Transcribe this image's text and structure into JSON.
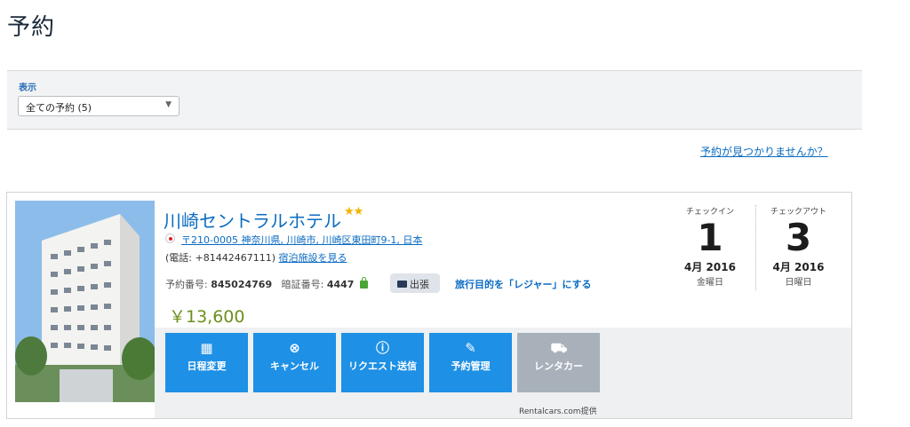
{
  "page": {
    "title": "予約"
  },
  "filter": {
    "label": "表示",
    "selected": "全ての予約 (5)"
  },
  "not_found_link": "予約が見つかりませんか？",
  "booking": {
    "hotel_name": "川崎セントラルホテル",
    "stars": "★★",
    "address": "〒210-0005 神奈川県, 川崎市, 川崎区東田町9-1, 日本",
    "phone_text": "(電話: +81442467111)",
    "property_link": "宿泊施設を見る",
    "booking_number_label": "予約番号:",
    "booking_number": "845024769",
    "pin_label": "暗証番号:",
    "pin": "4447",
    "trip_type": "出張",
    "purpose_link": "旅行目的を「レジャー」にする",
    "price": "￥13,600",
    "checkin": {
      "label": "チェックイン",
      "day": "1",
      "month": "4月 2016",
      "weekday": "金曜日"
    },
    "checkout": {
      "label": "チェックアウト",
      "day": "3",
      "month": "4月 2016",
      "weekday": "日曜日"
    },
    "actions": [
      {
        "label": "日程変更",
        "icon": "calendar-icon"
      },
      {
        "label": "キャンセル",
        "icon": "close-circle-icon"
      },
      {
        "label": "リクエスト送信",
        "icon": "info-icon"
      },
      {
        "label": "予約管理",
        "icon": "pencil-icon"
      },
      {
        "label": "レンタカー",
        "icon": "car-icon"
      }
    ],
    "provided_by": "Rentalcars.com提供"
  },
  "colors": {
    "link": "#0a6bc1",
    "button": "#1e90e5",
    "disabled_button": "#a8b1ba",
    "price": "#6c8f1d",
    "stars": "#f5b301"
  }
}
